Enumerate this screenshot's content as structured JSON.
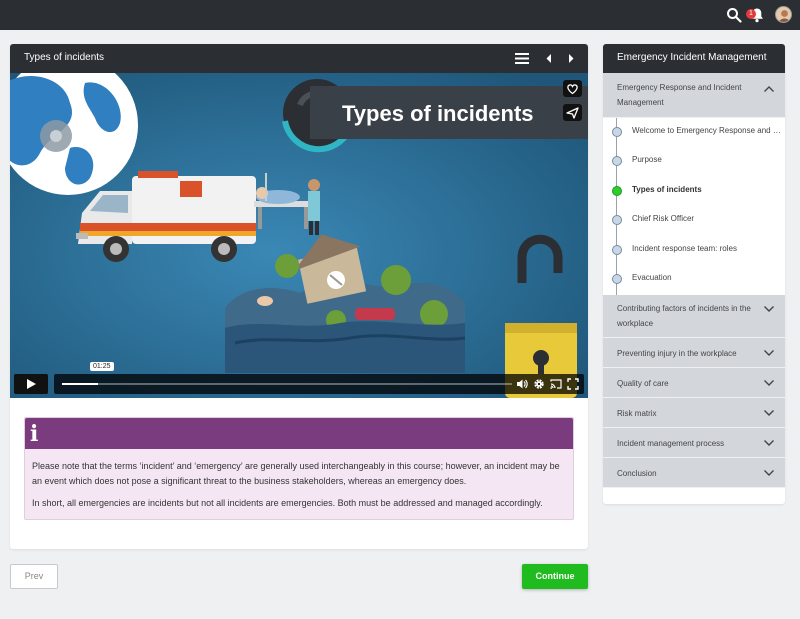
{
  "topbar": {
    "notification_count": "1"
  },
  "player": {
    "title": "Types of incidents",
    "video_heading": "Types of incidents",
    "current_time": "01:25",
    "progress": 0.08
  },
  "info_box": {
    "icon": "i",
    "paragraph_1": "Please note that the terms ‘incident’ and ‘emergency’ are generally used interchangeably in this course; however, an incident may be an event which does not pose a significant threat to the business stakeholders, whereas an emergency does.",
    "paragraph_2": "In short, all emergencies are incidents but not all incidents are emergencies. Both must be addressed and managed accordingly."
  },
  "buttons": {
    "prev_label": "Prev",
    "continue_label": "Continue"
  },
  "sidebar": {
    "title": "Emergency Incident Management",
    "open_section": "Emergency Response and Incident Management",
    "lessons": [
      {
        "label": "Welcome to Emergency Response and Incident Management",
        "active": false
      },
      {
        "label": "Purpose",
        "active": false
      },
      {
        "label": "Types of incidents",
        "active": true
      },
      {
        "label": "Chief Risk Officer",
        "active": false
      },
      {
        "label": "Incident response team: roles",
        "active": false
      },
      {
        "label": "Evacuation",
        "active": false
      }
    ],
    "sections": [
      "Contributing factors of incidents in the workplace",
      "Preventing injury in the workplace",
      "Quality of care",
      "Risk matrix",
      "Incident management process",
      "Conclusion"
    ]
  },
  "colors": {
    "dark": "#2b2e33",
    "accent_green": "#1fbb1f",
    "info_purple": "#7a3b7f",
    "info_bg": "#f5e6f4",
    "sidebar_section": "#d3d7dc"
  }
}
